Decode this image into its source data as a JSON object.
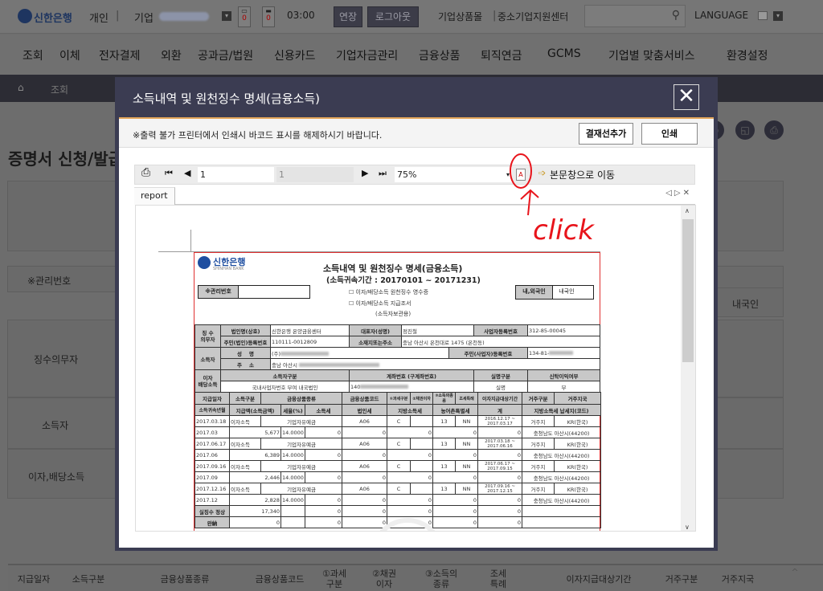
{
  "header": {
    "logo": "신한은행",
    "personal": "개인",
    "corporate": "기업",
    "cart_count": "0",
    "message_count": "0",
    "timer": "03:00",
    "extend_label": "연장",
    "logout_label": "로그아웃",
    "links": [
      "기업상품몰",
      "중소기업지원센터"
    ],
    "language_label": "LANGUAGE"
  },
  "nav": [
    "조회",
    "이체",
    "전자결제",
    "외환",
    "공과금/법원",
    "신용카드",
    "기업자금관리",
    "금융상품",
    "퇴직연금",
    "GCMS",
    "기업별 맞춤서비스",
    "환경설정"
  ],
  "breadcrumb": [
    "조회"
  ],
  "page": {
    "title": "증명서 신청/발급",
    "mgmt_label": "※관리번호",
    "domestic_value": "내국인",
    "sections": [
      "징수의무자",
      "소득자",
      "이자,배당소득"
    ],
    "bottom_headers": [
      "지급일자",
      "소득구분",
      "금융상품종류",
      "금융상품코드",
      "①과세\n구분",
      "②채권\n이자",
      "③소득의\n종류",
      "조세\n특례",
      "이자지급대상기간",
      "거주구분",
      "거주지국"
    ]
  },
  "modal": {
    "title": "소득내역 및 원천징수 명세(금융소득)",
    "notice": "※출력 불가 프린터에서 인쇄시 바코드 표시를 해제하시기 바랍니다.",
    "approval_button": "결재선추가",
    "print_button": "인쇄",
    "viewer": {
      "current_page": "1",
      "total_pages": "1",
      "zoom": "75%",
      "goto_main": "본문창으로 이동",
      "tab": "report"
    }
  },
  "report": {
    "bank_name": "신한은행",
    "bank_name_en": "SHINHAN BANK",
    "title": "소득내역 및 원천징수 명세(금융소득)",
    "period": "(소득귀속기간 : 20170101 ~ 20171231)",
    "mgmt_label": "※관리번호",
    "checkbox1": "이자/배당소득 원천징수 영수증",
    "checkbox2": "이자/배당소득 지급조서",
    "copy_note": "(소득자보관용)",
    "resident_label": "내,외국인",
    "resident_value": "내국인",
    "payer": {
      "label": "징 수\n의무자",
      "corp_name_label": "법인명(상호)",
      "corp_name": "신한은행 온양금융센터",
      "rep_label": "대표자(성명)",
      "rep": "정진철",
      "bizno_label": "사업자등록번호",
      "bizno": "312-85-00045",
      "regno_label": "주민(법인)등록번호",
      "regno": "110111-0012809",
      "addr_label": "소재지또는주소",
      "addr": "충남 아산시 온천대로 1475 (온천동)"
    },
    "earner": {
      "label": "소득자",
      "name_label": "성    명",
      "name": "(주)",
      "regno_label": "주민(사업자)등록번호",
      "regno": "134-81-",
      "addr_label": "주    소",
      "addr": "충남 아산시"
    },
    "interest": {
      "label": "이자\n배당소득",
      "type_label": "소득자구분",
      "type": "국내사업자번호 부여 내국법인",
      "account_label": "계좌번호 (구계좌번호)",
      "account": "140",
      "realname_label": "실명구분",
      "realname": "실명",
      "trust_label": "신탁이익여부",
      "trust": "부"
    },
    "detail_header1": [
      "지급일자",
      "소득구분",
      "금융상품종류",
      "금융상품코드",
      "①과세구분",
      "②채권이자",
      "③소득의종류",
      "조세특례",
      "이자지급대상기간",
      "거주구분",
      "거주지국"
    ],
    "detail_header2": [
      "소득귀속년월",
      "지급액(소득금액)",
      "세율(%)",
      "소득세",
      "법인세",
      "지방소득세",
      "농어촌특별세",
      "계",
      "지방소득세 납세지(코드)"
    ],
    "rows": [
      {
        "date": "2017.03.18",
        "type": "이자소득",
        "product": "기업자유예금",
        "code": "A06",
        "tax_type": "C",
        "bond": "",
        "kind": "13",
        "special": "NN",
        "period": "2016.12.17 ~ 2017.03.17",
        "residence": "거주지",
        "country": "KR(한국)",
        "ym": "2017.03",
        "amount": "5,677",
        "rate": "14.0000",
        "income_tax": "0",
        "corp_tax": "0",
        "local_tax": "0",
        "rural_tax": "0",
        "total": "0",
        "local_addr": "충청남도 아산시(44200)"
      },
      {
        "date": "2017.06.17",
        "type": "이자소득",
        "product": "기업자유예금",
        "code": "A06",
        "tax_type": "C",
        "bond": "",
        "kind": "13",
        "special": "NN",
        "period": "2017.03.18 ~ 2017.06.16",
        "residence": "거주지",
        "country": "KR(한국)",
        "ym": "2017.06",
        "amount": "6,389",
        "rate": "14.0000",
        "income_tax": "0",
        "corp_tax": "0",
        "local_tax": "0",
        "rural_tax": "0",
        "total": "0",
        "local_addr": "충청남도 아산시(44200)"
      },
      {
        "date": "2017.09.16",
        "type": "이자소득",
        "product": "기업자유예금",
        "code": "A06",
        "tax_type": "C",
        "bond": "",
        "kind": "13",
        "special": "NN",
        "period": "2017.06.17 ~ 2017.09.15",
        "residence": "거주지",
        "country": "KR(한국)",
        "ym": "2017.09",
        "amount": "2,446",
        "rate": "14.0000",
        "income_tax": "0",
        "corp_tax": "0",
        "local_tax": "0",
        "rural_tax": "0",
        "total": "0",
        "local_addr": "충청남도 아산시(44200)"
      },
      {
        "date": "2017.12.16",
        "type": "이자소득",
        "product": "기업자유예금",
        "code": "A06",
        "tax_type": "C",
        "bond": "",
        "kind": "13",
        "special": "NN",
        "period": "2017.09.16 ~ 2017.12.15",
        "residence": "거주지",
        "country": "KR(한국)",
        "ym": "2017.12",
        "amount": "2,828",
        "rate": "14.0000",
        "income_tax": "0",
        "corp_tax": "0",
        "local_tax": "0",
        "rural_tax": "0",
        "total": "0",
        "local_addr": "충청남도 아산시(44200)"
      }
    ],
    "summary_label": "실징수",
    "summary": [
      {
        "label": "정상",
        "amount": "17,340",
        "income_tax": "0",
        "corp_tax": "0",
        "local_tax": "0",
        "rural_tax": "0",
        "total": "0"
      },
      {
        "label": "완納",
        "amount": "0",
        "income_tax": "0",
        "corp_tax": "0",
        "local_tax": "0",
        "rural_tax": "0",
        "total": "0"
      }
    ]
  },
  "annotation": {
    "text": "click",
    "color": "#e8141b"
  }
}
